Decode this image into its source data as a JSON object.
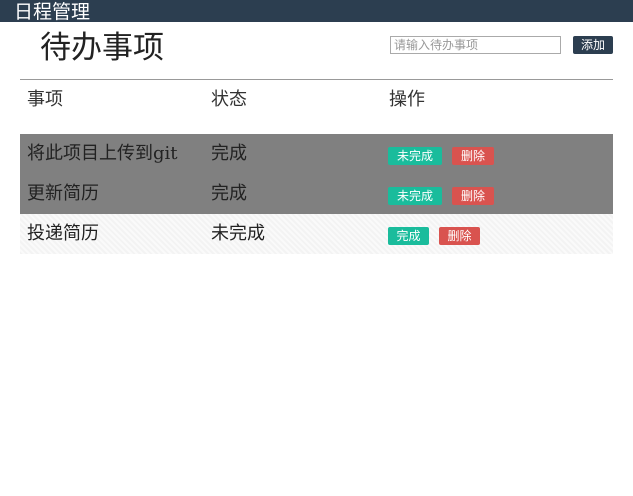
{
  "app": {
    "title": "日程管理"
  },
  "header": {
    "page_title": "待办事项",
    "input_placeholder": "请输入待办事项",
    "add_label": "添加"
  },
  "table": {
    "columns": [
      "事项",
      "状态",
      "操作"
    ],
    "rows": [
      {
        "item": "将此项目上传到git",
        "status": "完成",
        "toggle_label": "未完成",
        "delete_label": "删除"
      },
      {
        "item": "更新简历",
        "status": "完成",
        "toggle_label": "未完成",
        "delete_label": "删除"
      },
      {
        "item": "投递简历",
        "status": "未完成",
        "toggle_label": "完成",
        "delete_label": "删除"
      }
    ]
  },
  "colors": {
    "topbar": "#2c3e50",
    "done_row": "#808080",
    "toggle_button": "#1abc9c",
    "delete_button": "#d9534f"
  }
}
